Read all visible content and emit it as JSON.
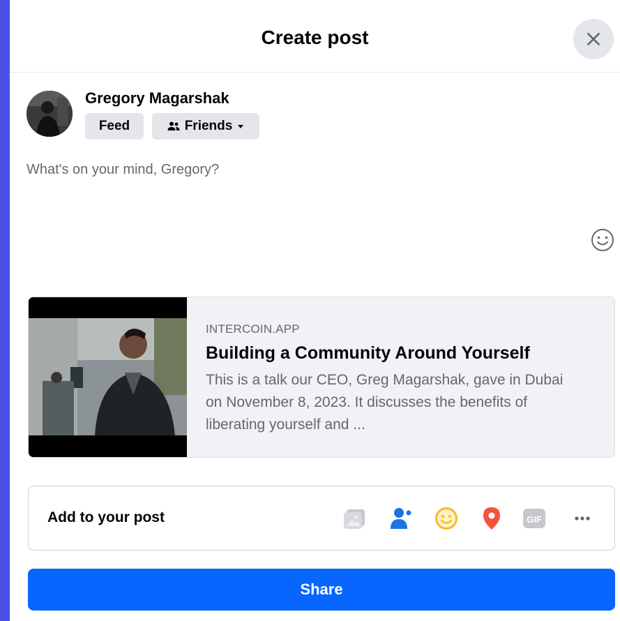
{
  "dialog": {
    "title": "Create post"
  },
  "author": {
    "name": "Gregory Magarshak",
    "feed_label": "Feed",
    "audience_label": "Friends"
  },
  "composer": {
    "placeholder": "What's on your mind, Gregory?"
  },
  "link_preview": {
    "domain": "INTERCOIN.APP",
    "title": "Building a Community Around Yourself",
    "description": "This is a talk our CEO, Greg Magarshak, gave in Dubai on November 8, 2023. It discusses the benefits of liberating yourself and ..."
  },
  "add_to_post": {
    "label": "Add to your post",
    "icons": [
      "photo-video-icon",
      "tag-people-icon",
      "feeling-activity-icon",
      "check-in-icon",
      "gif-icon",
      "more-icon"
    ]
  },
  "share": {
    "label": "Share"
  },
  "colors": {
    "accent": "#0866ff",
    "background": "#4a50e8",
    "tag_people": "#1b74e4",
    "feeling": "#f7b928",
    "check_in": "#f5533d",
    "disabled_icon": "#c5c7cb"
  }
}
